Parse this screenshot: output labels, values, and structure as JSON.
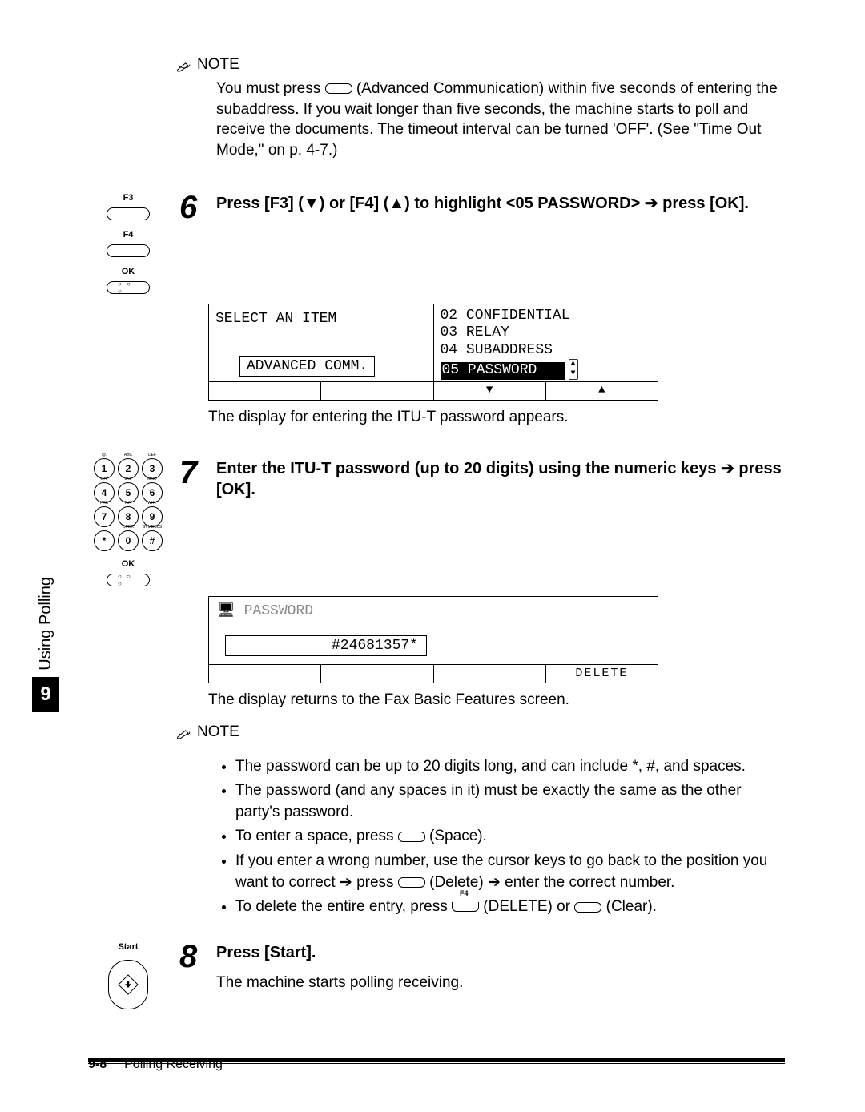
{
  "sideTab": {
    "label": "Using Polling",
    "num": "9"
  },
  "note1": {
    "header": "NOTE",
    "text": "You must press ",
    "text2": " (Advanced Communication) within five seconds of entering the subaddress. If you wait longer than five seconds, the machine starts to poll and receive the documents. The timeout interval can be turned 'OFF'. (See \"Time Out Mode,\" on p. 4-7.)"
  },
  "step6": {
    "num": "6",
    "keys": {
      "f3": "F3",
      "f4": "F4",
      "ok": "OK"
    },
    "title_a": "Press [F3] (▼) or [F4] (▲) to highlight <05 PASSWORD> ",
    "title_b": "press [OK].",
    "lcd": {
      "leftTitle": "SELECT AN ITEM",
      "advBox": "ADVANCED COMM.",
      "r1": "02 CONFIDENTIAL",
      "r2": "03 RELAY",
      "r3": "04 SUBADDRESS",
      "r4": "05 PASSWORD"
    },
    "caption": "The display for entering the ITU-T password appears."
  },
  "step7": {
    "num": "7",
    "ok": "OK",
    "title_a": "Enter the ITU-T password (up to 20 digits) using the numeric keys ",
    "title_b": " press [OK].",
    "lcd": {
      "label": "PASSWORD",
      "value": "#24681357*",
      "del": "DELETE"
    },
    "caption": "The display returns to the Fax Basic Features screen."
  },
  "note2": {
    "header": "NOTE",
    "b1": "The password can be up to 20 digits long, and can include *, #, and spaces.",
    "b2": "The password (and any spaces in it) must be exactly the same as the other party's password.",
    "b3a": "To enter a space, press ",
    "b3b": " (Space).",
    "b4a": "If you enter a wrong number, use the cursor keys to go back to the position you want to correct ",
    "b4b": " press ",
    "b4c": " (Delete) ",
    "b4d": " enter the correct number.",
    "b5a": "To delete the entire entry, press ",
    "b5b": " (DELETE) or ",
    "b5c": " (Clear).",
    "f4": "F4"
  },
  "step8": {
    "num": "8",
    "startLbl": "Start",
    "title": "Press [Start].",
    "caption": "The machine starts polling receiving."
  },
  "footer": {
    "page": "9-8",
    "section": "Polling Receiving"
  }
}
